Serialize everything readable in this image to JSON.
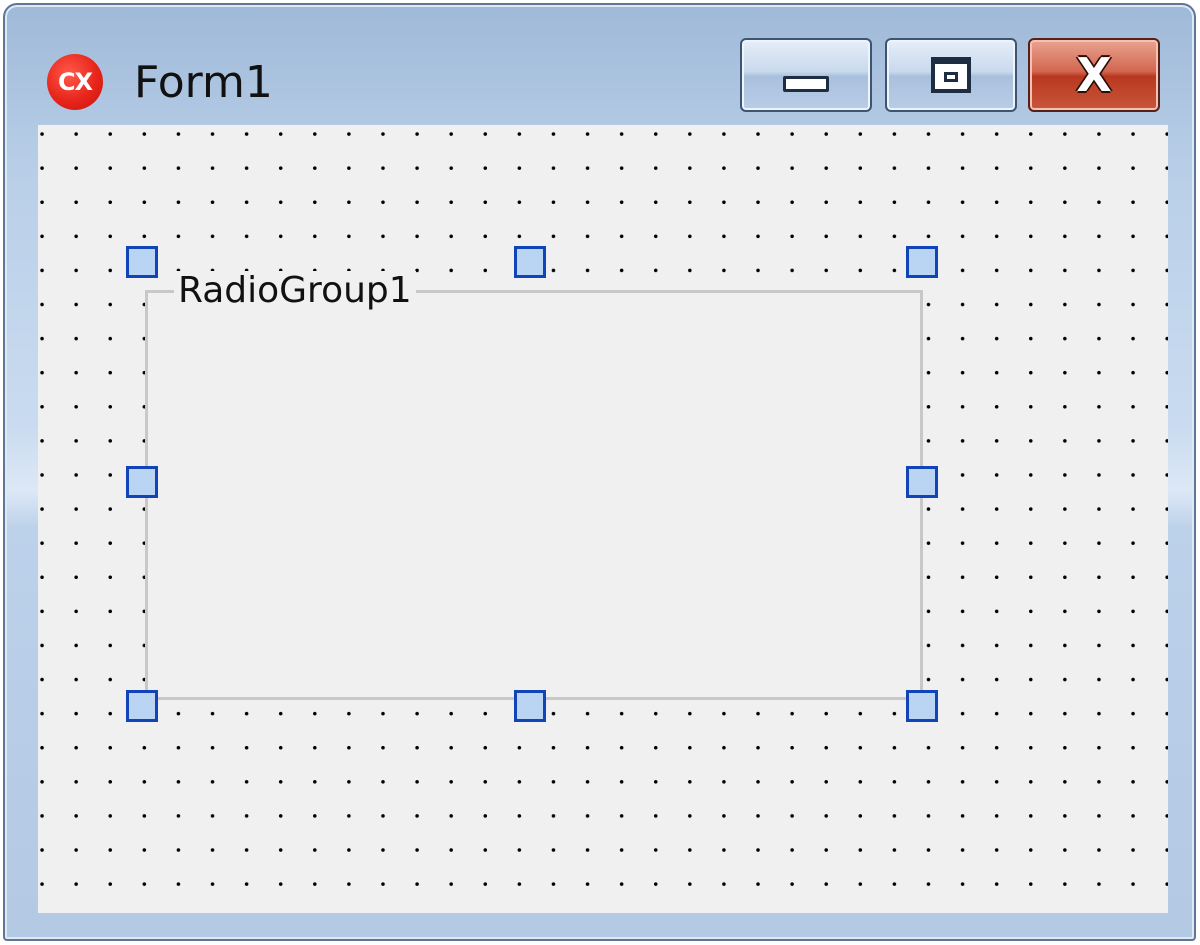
{
  "window": {
    "title": "Form1",
    "app_icon": {
      "icon": "cx-icon",
      "text": "CX",
      "color": "#e8251b"
    },
    "controls": {
      "minimize": {
        "icon": "minimize-icon"
      },
      "maximize": {
        "icon": "maximize-icon"
      },
      "close": {
        "icon": "close-icon",
        "glyph": "X",
        "color": "#c9563b"
      }
    }
  },
  "form": {
    "grid": "dotted",
    "background": "#f0f0f0",
    "radio_group": {
      "caption": "RadioGroup1",
      "selected": true,
      "selection_handle_color": "#1144b8"
    }
  }
}
